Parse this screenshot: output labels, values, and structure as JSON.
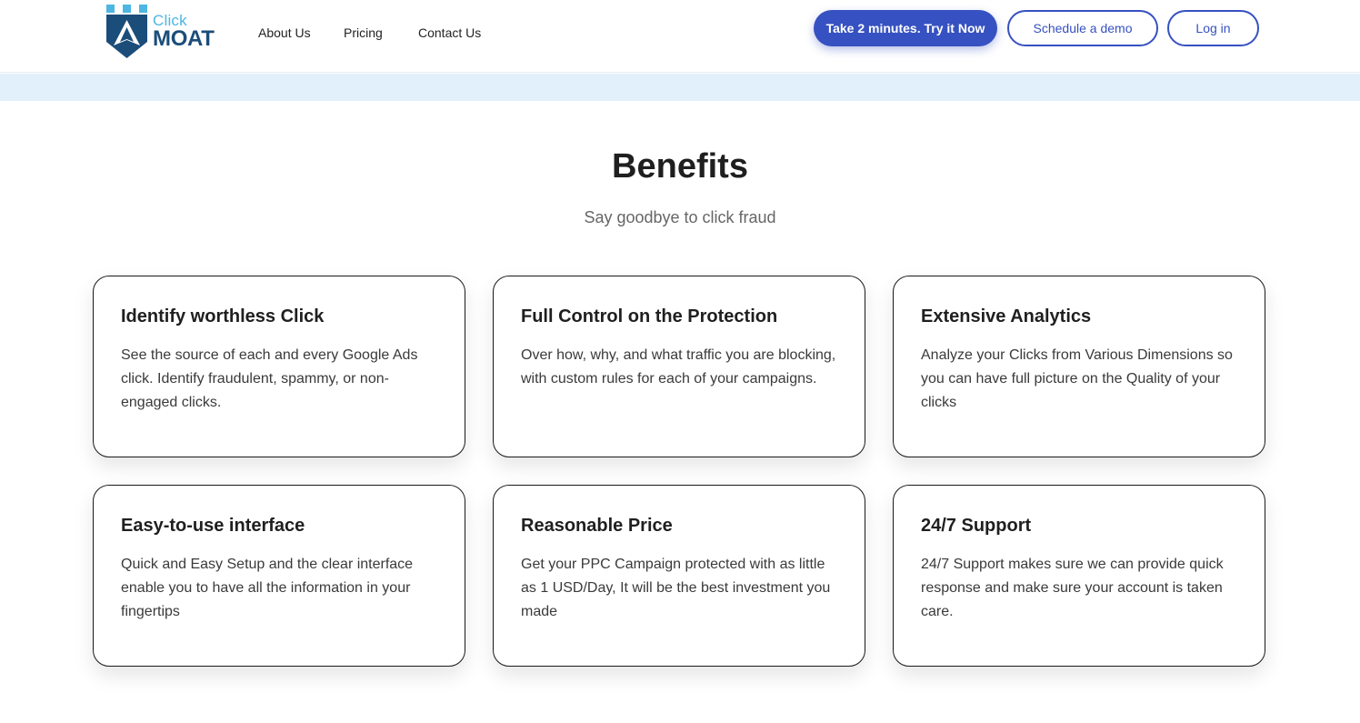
{
  "logo": {
    "top_text": "Click",
    "bottom_text": "MOAT"
  },
  "nav": {
    "about": "About Us",
    "pricing": "Pricing",
    "contact": "Contact Us"
  },
  "actions": {
    "try_now": "Take 2 minutes. Try it Now",
    "schedule": "Schedule a demo",
    "login": "Log in"
  },
  "section": {
    "title": "Benefits",
    "subtitle": "Say goodbye to click fraud"
  },
  "cards": [
    {
      "title": "Identify worthless Click",
      "text": "See the source of each and every Google Ads click. Identify fraudulent, spammy, or non-engaged clicks."
    },
    {
      "title": "Full Control on the Protection",
      "text": "Over how, why, and what traffic you are blocking, with custom rules for each of your campaigns."
    },
    {
      "title": "Extensive Analytics",
      "text": "Analyze your Clicks from Various Dimensions so you can have full picture on the Quality of your clicks"
    },
    {
      "title": "Easy-to-use interface",
      "text": "Quick and Easy Setup and the clear interface enable you to have all the information in your fingertips"
    },
    {
      "title": "Reasonable Price",
      "text": "Get your PPC Campaign protected with as little as 1 USD/Day, It will be the best investment you made"
    },
    {
      "title": "24/7 Support",
      "text": "24/7 Support makes sure we can provide quick response and make sure your account is taken care."
    }
  ],
  "colors": {
    "accent": "#3651c1",
    "band": "#e2f0fc",
    "logo_light": "#4db6e2",
    "logo_dark": "#1b4d7a"
  },
  "icons": {
    "logo": "castle-shield-logo-icon"
  }
}
